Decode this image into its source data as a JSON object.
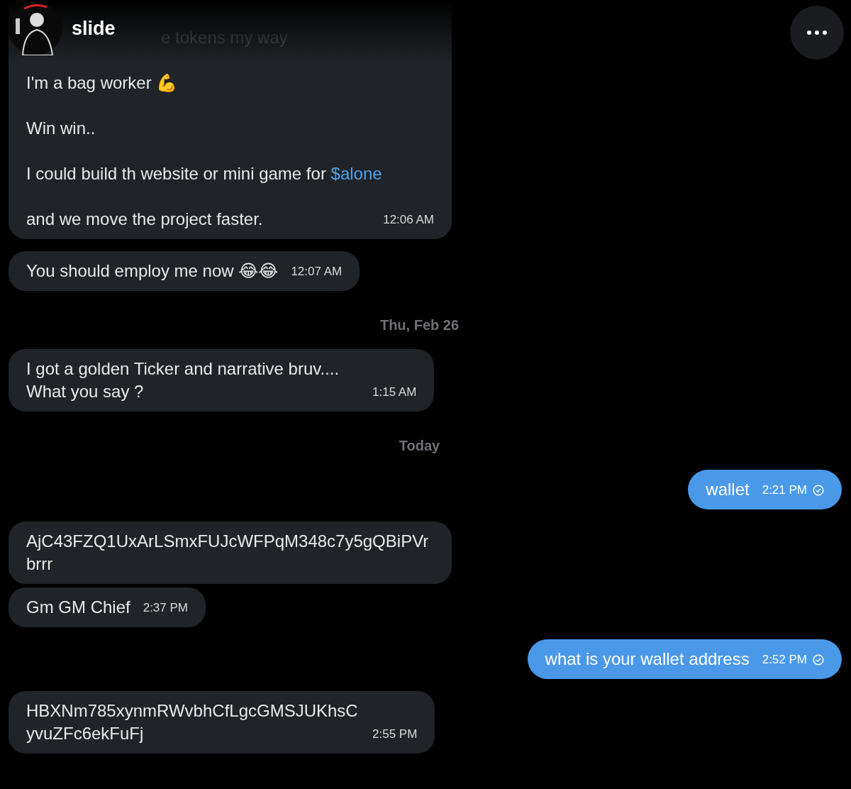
{
  "header": {
    "name": "slide"
  },
  "messages": [
    {
      "kind": "incoming",
      "paragraphs": [
        {
          "text": "e tokens my way",
          "faded": true
        },
        {
          "text": "I'm a bag worker 💪"
        },
        {
          "text": "Win win.."
        },
        {
          "text": "I could build th website or mini game for ",
          "link": "$alone"
        },
        {
          "text": "and we move the project faster."
        }
      ],
      "time": "12:06 AM"
    },
    {
      "kind": "incoming",
      "paragraphs": [
        {
          "text": "You should employ me now 😂😂"
        }
      ],
      "time": "12:07 AM"
    },
    {
      "kind": "date",
      "text": "Thu, Feb 26"
    },
    {
      "kind": "incoming",
      "paragraphs": [
        {
          "text": "I got a golden Ticker and narrative bruv.... What you say ?"
        }
      ],
      "time": "1:15 AM"
    },
    {
      "kind": "date",
      "text": "Today"
    },
    {
      "kind": "outgoing",
      "paragraphs": [
        {
          "text": "wallet"
        }
      ],
      "time": "2:21 PM",
      "seen": true
    },
    {
      "kind": "incoming",
      "paragraphs": [
        {
          "text": "AjC43FZQ1UxArLSmxFUJcWFPqM348c7y5gQBiPVrbrrr"
        }
      ]
    },
    {
      "kind": "incoming",
      "paragraphs": [
        {
          "text": "Gm GM Chief"
        }
      ],
      "time": "2:37 PM"
    },
    {
      "kind": "outgoing",
      "paragraphs": [
        {
          "text": "what is your wallet address"
        }
      ],
      "time": "2:52 PM",
      "seen": true
    },
    {
      "kind": "incoming",
      "paragraphs": [
        {
          "text": "HBXNm785xynmRWvbhCfLgcGMSJUKhsCyvuZFc6ekFuFj"
        }
      ],
      "time": "2:55 PM"
    }
  ]
}
